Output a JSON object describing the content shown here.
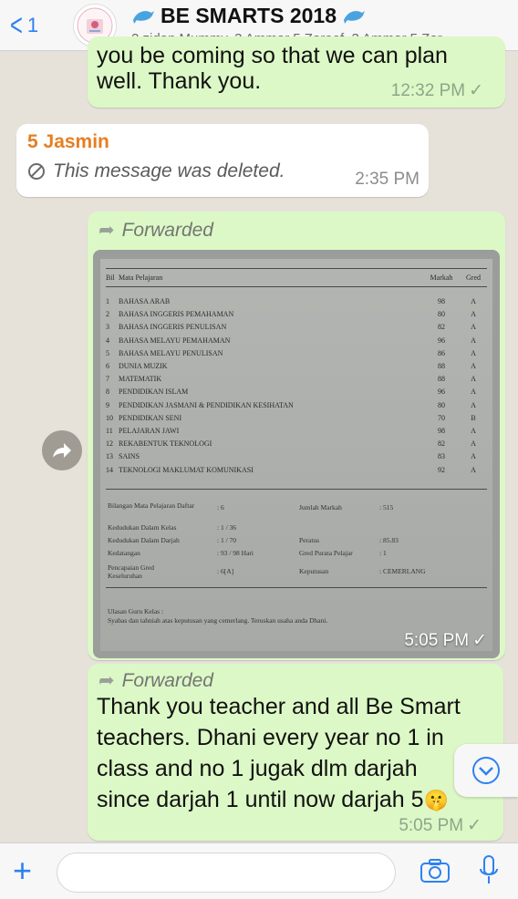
{
  "header": {
    "back_count": "1",
    "title": "BE SMARTS 2018",
    "subtitle": "2 zidan Mummy, 3 Ammar 5 Zareef, 3 Ammar 5 Zar..."
  },
  "messages": [
    {
      "partial_text": "you be coming so that we can plan",
      "text": "well. Thank you.",
      "time": "12:32 PM",
      "status": "✓"
    },
    {
      "sender": "5 Jasmin",
      "deleted_text": "This message was deleted.",
      "time": "2:35 PM"
    },
    {
      "forwarded_label": "Forwarded",
      "time": "5:05 PM",
      "status": "✓",
      "report": {
        "headers": [
          "Bil",
          "Mata Pelajaran",
          "Markah",
          "Gred"
        ],
        "rows": [
          [
            "1",
            "BAHASA ARAB",
            "98",
            "A"
          ],
          [
            "2",
            "BAHASA INGGERIS PEMAHAMAN",
            "80",
            "A"
          ],
          [
            "3",
            "BAHASA INGGERIS PENULISAN",
            "82",
            "A"
          ],
          [
            "4",
            "BAHASA MELAYU PEMAHAMAN",
            "96",
            "A"
          ],
          [
            "5",
            "BAHASA MELAYU PENULISAN",
            "86",
            "A"
          ],
          [
            "6",
            "DUNIA MUZIK",
            "88",
            "A"
          ],
          [
            "7",
            "MATEMATIK",
            "88",
            "A"
          ],
          [
            "8",
            "PENDIDIKAN ISLAM",
            "96",
            "A"
          ],
          [
            "9",
            "PENDIDIKAN JASMANI & PENDIDIKAN KESIHATAN",
            "80",
            "A"
          ],
          [
            "10",
            "PENDIDIKAN SENI",
            "70",
            "B"
          ],
          [
            "11",
            "PELAJARAN JAWI",
            "98",
            "A"
          ],
          [
            "12",
            "REKABENTUK TEKNOLOGI",
            "82",
            "A"
          ],
          [
            "13",
            "SAINS",
            "83",
            "A"
          ],
          [
            "14",
            "TEKNOLOGI MAKLUMAT KOMUNIKASI",
            "92",
            "A"
          ]
        ],
        "summary": {
          "bilangan_label": "Bilangan Mata Pelajaran Daftar",
          "bilangan": ": 6",
          "kedudukan_kelas_label": "Kedudukan Dalam Kelas",
          "kedudukan_kelas": ": 1 / 36",
          "kedudukan_darjah_label": "Kedudukan Dalam Darjah",
          "kedudukan_darjah": ": 1 / 70",
          "kedatangan_label": "Kedatangan",
          "kedatangan": ": 93 / 98 Hari",
          "pencapaian_label": "Pencapaian Gred Keseluruhan",
          "pencapaian": ": 6[A]",
          "jumlah_label": "Jumlah Markah",
          "jumlah": ": 515",
          "peratus_label": "Peratus",
          "peratus": ": 85.83",
          "gred_purata_label": "Gred Purata Pelajar",
          "gred_purata": ": 1",
          "keputusan_label": "Keputusan",
          "keputusan": ": CEMERLANG",
          "ulasan_label": "Ulasan Guru Kelas :",
          "ulasan": "Syabas dan tahniah atas keputusan yang cemerlang. Teruskan usaha anda Dhani."
        }
      }
    },
    {
      "forwarded_label": "Forwarded",
      "lines": [
        "Thank you teacher and all  Be Smart",
        "teachers. Dhani every year no 1 in",
        "class and no 1 jugak dlm darjah",
        "since darjah 1 until now darjah 5"
      ],
      "emoji": "🤫",
      "time": "5:05 PM",
      "status": "✓"
    }
  ],
  "footer": {
    "input_placeholder": ""
  },
  "colors": {
    "accent": "#2d82f0",
    "outgoing_bubble": "#dcf8c6",
    "incoming_bubble": "#ffffff",
    "sender_name": "#e67e22",
    "background": "#e6e2da"
  },
  "icons": [
    "back-chevron-icon",
    "dolphin-icon",
    "block-icon",
    "forward-arrow-icon",
    "share-icon",
    "chevron-down-icon",
    "plus-icon",
    "camera-icon",
    "microphone-icon"
  ]
}
